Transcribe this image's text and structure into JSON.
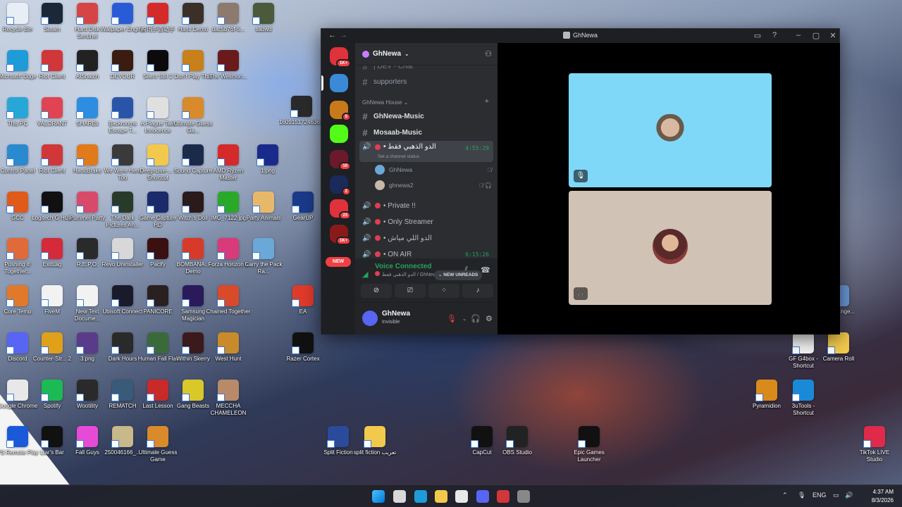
{
  "desktop": {
    "icons": [
      {
        "label": "Recycle Bin",
        "icon": "recycle-bin-icon",
        "color": "#e8eef6"
      },
      {
        "label": "Steam",
        "icon": "steam-icon",
        "color": "#1b2838"
      },
      {
        "label": "Hard Disk Sentinel",
        "icon": "hard-disk-icon",
        "color": "#d64545"
      },
      {
        "label": "Wallpaper Engine",
        "icon": "wallpaper-engine-icon",
        "color": "#2a5bd7"
      },
      {
        "label": "腾讯手游助手",
        "icon": "tencent-icon",
        "color": "#d42a2a"
      },
      {
        "label": "Hariti Demo",
        "icon": "game-icon",
        "color": "#3b3028"
      },
      {
        "label": "dac5b76f-5...",
        "icon": "image-file-icon",
        "color": "#8c7a6e"
      },
      {
        "label": "sadwd",
        "icon": "game-icon",
        "color": "#4a5a3a"
      },
      {
        "label": "Microsoft Edge",
        "icon": "edge-icon",
        "color": "#1f9bd8"
      },
      {
        "label": "Riot Client",
        "icon": "riot-icon",
        "color": "#d13639"
      },
      {
        "label": "AISnatch",
        "icon": "app-icon",
        "color": "#222222"
      },
      {
        "label": "DEVOUR",
        "icon": "game-icon",
        "color": "#3a1c10"
      },
      {
        "label": "Silent Still 2",
        "icon": "game-icon",
        "color": "#0b0b0b"
      },
      {
        "label": "Don't Play This",
        "icon": "game-icon",
        "color": "#c7801a"
      },
      {
        "label": "The Wellmon...",
        "icon": "game-icon",
        "color": "#6a1a1a"
      },
      {
        "label": "This PC",
        "icon": "this-pc-icon",
        "color": "#27a7d8"
      },
      {
        "label": "VALORANT",
        "icon": "valorant-icon",
        "color": "#e04451"
      },
      {
        "label": "SHAREit",
        "icon": "shareit-icon",
        "color": "#2d8de0"
      },
      {
        "label": "Backrooms Escape T...",
        "icon": "game-icon",
        "color": "#2a54a8"
      },
      {
        "label": "A Plague Tale Innocence",
        "icon": "game-icon",
        "color": "#e0e0e0"
      },
      {
        "label": "Ultimate Guess Ga...",
        "icon": "game-icon",
        "color": "#d98a2a"
      },
      {
        "label": "Control Panel",
        "icon": "control-panel-icon",
        "color": "#2a8ad0"
      },
      {
        "label": "Riot Client",
        "icon": "riot-icon",
        "color": "#d13639"
      },
      {
        "label": "HandBrake",
        "icon": "handbrake-icon",
        "color": "#e07a1a"
      },
      {
        "label": "We Were Here Too",
        "icon": "game-icon",
        "color": "#3a3a3a"
      },
      {
        "label": "Deep-Live-... - Shortcut",
        "icon": "folder-icon",
        "color": "#f2c94c"
      },
      {
        "label": "Sound Capture",
        "icon": "sound-capture-icon",
        "color": "#1c2a4a"
      },
      {
        "label": "AMD Ryzen Master",
        "icon": "amd-icon",
        "color": "#d42a2a"
      },
      {
        "label": "GCC",
        "icon": "gcc-icon",
        "color": "#e05a1a"
      },
      {
        "label": "Logitech G HUB",
        "icon": "logitech-icon",
        "color": "#111111"
      },
      {
        "label": "Pummel Party",
        "icon": "game-icon",
        "color": "#d84a6a"
      },
      {
        "label": "The Dark Pictures An...",
        "icon": "game-icon",
        "color": "#2a3a2a"
      },
      {
        "label": "Game Capture HD",
        "icon": "capture-icon",
        "color": "#1a2a6a"
      },
      {
        "label": "Witch's Doll",
        "icon": "game-icon",
        "color": "#2a1a1a"
      },
      {
        "label": "IMG_7122.jpg",
        "icon": "image-file-icon",
        "color": "#2aa82a"
      },
      {
        "label": "Party Animals",
        "icon": "game-icon",
        "color": "#e8b86a"
      },
      {
        "label": "Pushing it! Together...",
        "icon": "game-icon",
        "color": "#e06a3a"
      },
      {
        "label": "ExitLag",
        "icon": "exitlag-icon",
        "color": "#d42a3a"
      },
      {
        "label": "R.E.P.O.",
        "icon": "game-icon",
        "color": "#2a2a2a"
      },
      {
        "label": "Revo Uninstaller",
        "icon": "revo-icon",
        "color": "#d8d8d8"
      },
      {
        "label": "Pacify",
        "icon": "game-icon",
        "color": "#3a1010"
      },
      {
        "label": "BOMBANA... Demo",
        "icon": "game-icon",
        "color": "#d83a2a"
      },
      {
        "label": "Forza Horizon 5",
        "icon": "game-icon",
        "color": "#d83a7a"
      },
      {
        "label": "Carry the Pack Ra...",
        "icon": "game-icon",
        "color": "#6aa8d8"
      },
      {
        "label": "Core Temp",
        "icon": "core-temp-icon",
        "color": "#e07a2a"
      },
      {
        "label": "FiveM",
        "icon": "file-icon",
        "color": "#f2f2f2"
      },
      {
        "label": "New Text Docume...",
        "icon": "text-file-icon",
        "color": "#f2f2f2"
      },
      {
        "label": "Ubisoft Connect",
        "icon": "ubisoft-icon",
        "color": "#1a1a2a"
      },
      {
        "label": "PANICORE",
        "icon": "game-icon",
        "color": "#2a2020"
      },
      {
        "label": "Samsung Magician",
        "icon": "samsung-icon",
        "color": "#2a1a5a"
      },
      {
        "label": "Chained Together",
        "icon": "game-icon",
        "color": "#d84a2a"
      },
      {
        "label": "EA",
        "icon": "ea-icon",
        "color": "#e03a2a"
      },
      {
        "label": "Discord",
        "icon": "discord-icon",
        "color": "#5865f2"
      },
      {
        "label": "Counter-Str... 2",
        "icon": "cs2-icon",
        "color": "#e0a01a"
      },
      {
        "label": "3.png",
        "icon": "image-file-icon",
        "color": "#5a3a8a"
      },
      {
        "label": "Dark Hours",
        "icon": "game-icon",
        "color": "#2a2a2a"
      },
      {
        "label": "Human Fall Flat",
        "icon": "game-icon",
        "color": "#3a6a3a"
      },
      {
        "label": "Within Skerry",
        "icon": "game-icon",
        "color": "#3a1a1a"
      },
      {
        "label": "West Hunt",
        "icon": "game-icon",
        "color": "#c88a2a"
      },
      {
        "label": "Razer Cortex",
        "icon": "razer-icon",
        "color": "#111111"
      },
      {
        "label": "Google Chrome",
        "icon": "chrome-icon",
        "color": "#e8e8e8"
      },
      {
        "label": "Spotify",
        "icon": "spotify-icon",
        "color": "#1db954"
      },
      {
        "label": "Wootility",
        "icon": "wootility-icon",
        "color": "#2a2a2a"
      },
      {
        "label": "REMATCH",
        "icon": "game-icon",
        "color": "#3a5a7a"
      },
      {
        "label": "Last Lesson",
        "icon": "game-icon",
        "color": "#c82a2a"
      },
      {
        "label": "Gang Beasts",
        "icon": "game-icon",
        "color": "#d8c82a"
      },
      {
        "label": "MECCHA CHAMELEON",
        "icon": "game-icon",
        "color": "#b88a6a"
      },
      {
        "label": "PS Remote Play",
        "icon": "ps-remote-icon",
        "color": "#1a5ad8"
      },
      {
        "label": "Liar's Bar",
        "icon": "game-icon",
        "color": "#111111"
      },
      {
        "label": "Fall Guys",
        "icon": "game-icon",
        "color": "#e84ad8"
      },
      {
        "label": "250046166_...",
        "icon": "image-file-icon",
        "color": "#c8b88a"
      },
      {
        "label": "Ultimate Guess Game",
        "icon": "game-icon",
        "color": "#d98a2a"
      },
      {
        "label": "1609151724636.jpeg",
        "icon": "image-file-icon",
        "color": "#2a2a2a"
      },
      {
        "label": "1.png",
        "icon": "image-file-icon",
        "color": "#1a2a8a"
      },
      {
        "label": "GearUP",
        "icon": "gearup-icon",
        "color": "#1a3a8a"
      },
      {
        "label": "Split Fiction",
        "icon": "game-icon",
        "color": "#2a4a9a"
      },
      {
        "label": "split fiction تعريب",
        "icon": "folder-icon",
        "color": "#f2c94c"
      },
      {
        "label": "CapCut",
        "icon": "capcut-icon",
        "color": "#111111"
      },
      {
        "label": "OBS Studio",
        "icon": "obs-icon",
        "color": "#222222"
      },
      {
        "label": "Epic Games Launcher",
        "icon": "epic-games-icon",
        "color": "#111111"
      },
      {
        "label": "...eel ...nge...",
        "icon": "app-icon",
        "color": "#6a9ad8"
      },
      {
        "label": "GF G4box - Shortcut",
        "icon": "file-icon",
        "color": "#f2f2f2"
      },
      {
        "label": "Camera Roll",
        "icon": "folder-icon",
        "color": "#f2c94c"
      },
      {
        "label": "Pyramidion",
        "icon": "game-icon",
        "color": "#d88a1a"
      },
      {
        "label": "3uTools - Shortcut",
        "icon": "3utools-icon",
        "color": "#1a8ad8"
      },
      {
        "label": "TikTok LIVE Studio",
        "icon": "tiktok-icon",
        "color": "#e02a4a"
      }
    ]
  },
  "discord": {
    "window_title": "GhNewa",
    "server_name": "GhNewa",
    "guilds": [
      {
        "icon": "discord-home-icon",
        "color": "#e0323a",
        "badge": "1K+"
      },
      {
        "icon": "server-icon",
        "color": "#3a8ad8",
        "badge": ""
      },
      {
        "icon": "server-icon",
        "color": "#c87a1a",
        "badge": "5"
      },
      {
        "icon": "kick-icon",
        "color": "#53fc18",
        "badge": ""
      },
      {
        "icon": "server-icon",
        "color": "#6a1a2a",
        "badge": "10"
      },
      {
        "icon": "server-icon",
        "color": "#1a2a5a",
        "badge": "2"
      },
      {
        "icon": "pubg-icon",
        "color": "#e0323a",
        "badge": "23"
      },
      {
        "icon": "server-icon",
        "color": "#8a1a1a",
        "badge": "1K+"
      }
    ],
    "new_tag": "NEW",
    "partial_channel": "| DEV - Chat",
    "channels_top": [
      "supporters"
    ],
    "category": "GhNewa House",
    "text_channels": [
      "GhNewa-Music",
      "Mosaab-Music"
    ],
    "active_voice": {
      "name": "• الدو الذهبي فقط",
      "time": "4:55:29",
      "status": "Set a channel status"
    },
    "voice_users": [
      {
        "name": "GhNewa",
        "color": "#6aa8d8",
        "icons": "🎙̸"
      },
      {
        "name": "ghnewa2",
        "color": "#c8b8a8",
        "icons": "🎙̸ 🎧"
      }
    ],
    "voice_channels": [
      {
        "name": "• Private !!",
        "time": ""
      },
      {
        "name": "• Only Streamer",
        "time": ""
      },
      {
        "name": "• الدو اللي مياش",
        "time": ""
      },
      {
        "name": "• ON AIR",
        "time": "6:15:26"
      }
    ],
    "new_unreads": "⌄ NEW UNREADS",
    "voice_connected": "Voice Connected",
    "voice_connected_sub": "الدو الذهبي فقط / GhNewa",
    "user": {
      "name": "GhNewa",
      "status": "Invisible"
    },
    "tiles": [
      {
        "bg": "#7fd8f8",
        "badge_icon": "mic-muted-icon"
      },
      {
        "bg": "#d0c2b4",
        "badge_icon": "headphones-icon"
      }
    ]
  },
  "taskbar": {
    "apps": [
      {
        "icon": "windows-start-icon",
        "color": "#3aa0ff"
      },
      {
        "icon": "task-view-icon",
        "color": "#d8d8d8"
      },
      {
        "icon": "edge-icon",
        "color": "#1f9bd8"
      },
      {
        "icon": "file-explorer-icon",
        "color": "#f2c94c"
      },
      {
        "icon": "chrome-icon",
        "color": "#e8e8e8"
      },
      {
        "icon": "discord-icon",
        "color": "#5865f2"
      },
      {
        "icon": "riot-icon",
        "color": "#d13639"
      },
      {
        "icon": "app-icon",
        "color": "#888888"
      }
    ],
    "lang": "ENG",
    "time": "4:37 AM",
    "date": "8/3/2026"
  }
}
